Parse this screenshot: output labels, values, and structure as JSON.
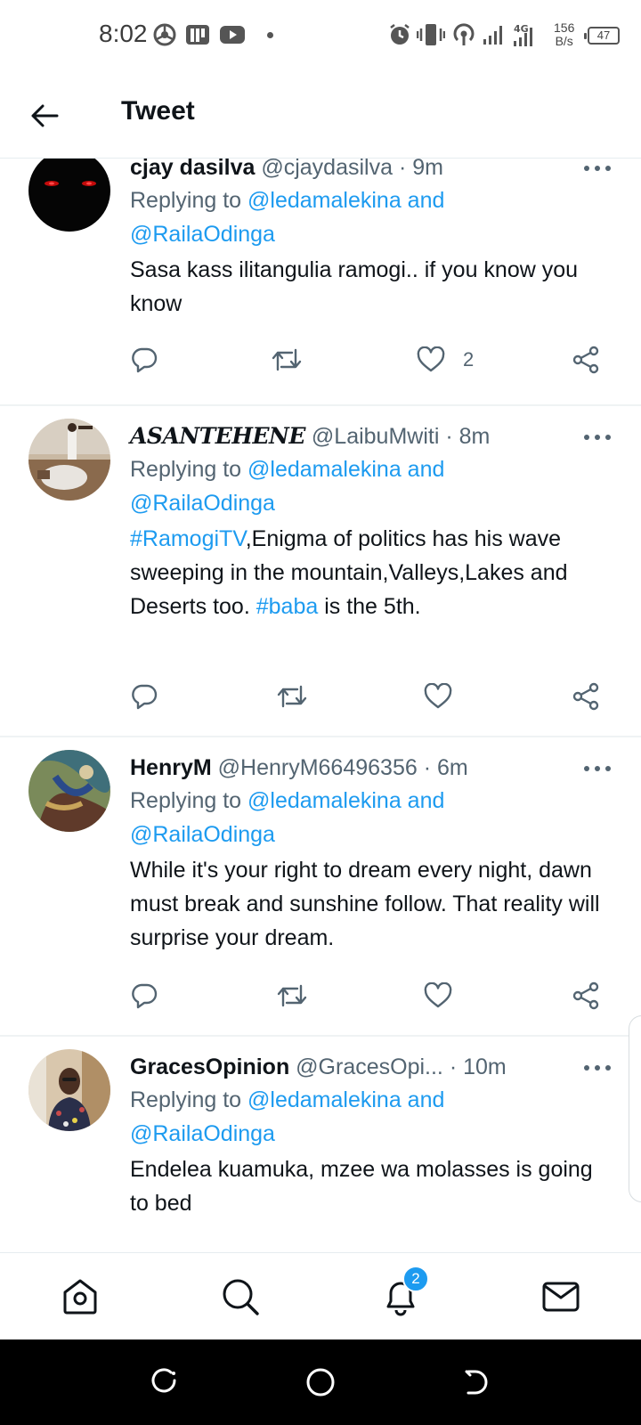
{
  "status_bar": {
    "time": "8:02",
    "network_speed": "156",
    "network_unit": "B/s",
    "network_type": "4G",
    "battery": "47",
    "icons": [
      "chrome-icon",
      "pinterest-icon",
      "youtube-icon",
      "dot-icon",
      "alarm-icon",
      "vibrate-icon",
      "hotspot-icon",
      "signal-icon",
      "signal-4g-icon",
      "battery-icon"
    ]
  },
  "header": {
    "title": "Tweet",
    "back_icon": "arrow-left-icon"
  },
  "reply_prefix": "Replying to",
  "tweets": [
    {
      "name": "cjay dasilva",
      "handle": "@cjaydasilva",
      "time": "· 9m",
      "mentions": "@ledamalekina and",
      "mentions2": "@RailaOdinga",
      "body": "Sasa kass ilitangulia ramogi.. if you know you know",
      "like_count": "2"
    },
    {
      "name": "𝑨𝑺𝑨𝑵𝑻𝑬𝑯𝑬𝑵𝑬",
      "handle": "@LaibuMwiti",
      "time": "· 8m",
      "mentions": "@ledamalekina and",
      "mentions2": "@RailaOdinga",
      "body_hashtag1": "#RamogiTV",
      "body_part1": ",Enigma of politics has his wave sweeping in the mountain,Valleys,Lakes and Deserts too.",
      "body_hashtag2": "#baba",
      "body_part2": " is the 5th.",
      "like_count": ""
    },
    {
      "name": "HenryM",
      "handle": "@HenryM66496356",
      "time": "· 6m",
      "mentions": "@ledamalekina and",
      "mentions2": "@RailaOdinga",
      "body": "While it's your right to dream every night, dawn must break and sunshine follow. That reality will surprise your dream.",
      "like_count": ""
    },
    {
      "name": "GracesOpinion",
      "handle": "@GracesOpi...",
      "time": "· 10m",
      "mentions": "@ledamalekina and",
      "mentions2": "@RailaOdinga",
      "body": "Endelea kuamuka, mzee wa molasses is going to bed",
      "like_count": ""
    }
  ],
  "bottom_nav": {
    "items": [
      "home-icon",
      "search-icon",
      "notifications-icon",
      "messages-icon"
    ],
    "notification_badge": "2"
  },
  "colors": {
    "accent": "#1d9bf0",
    "text": "#0f1419",
    "secondary": "#536471"
  }
}
